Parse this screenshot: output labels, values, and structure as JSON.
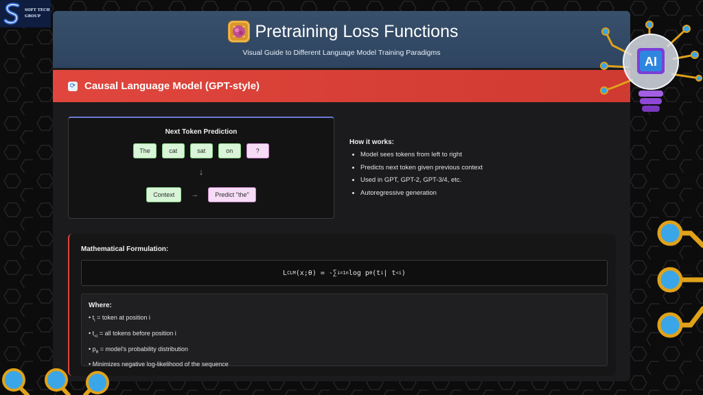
{
  "brand": {
    "line1": "SOFT TECH",
    "line2": "GROUP"
  },
  "header": {
    "title": "Pretraining Loss Functions",
    "subtitle": "Visual Guide to Different Language Model Training Paradigms"
  },
  "section": {
    "title": "Causal Language Model (GPT-style)",
    "icon": "refresh-icon"
  },
  "token_panel": {
    "title": "Next Token Prediction",
    "tokens": [
      "The",
      "cat",
      "sat",
      "on",
      "?"
    ],
    "arrow_down": "↓",
    "context_label": "Context",
    "arrow_right": "→",
    "prediction_label": "Predict \"the\""
  },
  "how": {
    "title": "How it works:",
    "items": [
      "Model sees tokens from left to right",
      "Predicts next token given previous context",
      "Used in GPT, GPT-2, GPT-3/4, etc.",
      "Autoregressive generation"
    ]
  },
  "math": {
    "title": "Mathematical Formulation:",
    "formula": {
      "lhs": "L",
      "lhs_sub": "CLM",
      "args": "(x;θ) = -∑",
      "sum_sub": "i=1",
      "sum_sup": "n",
      "rest": " log p",
      "p_sub": "θ",
      "paren_open": "(t",
      "t_sub": "i",
      "bar": " | t",
      "ctx_sub": "<i",
      "paren_close": ")"
    },
    "where_title": "Where:",
    "where": [
      {
        "pre": "• t",
        "sub": "i",
        "post": " = token at position i"
      },
      {
        "pre": "• t",
        "sub": "<i",
        "post": " = all tokens before position i"
      },
      {
        "pre": "• p",
        "sub": "θ",
        "post": " = model's probability distribution"
      },
      {
        "pre": "• Minimizes negative log-likelihood of the sequence",
        "sub": "",
        "post": ""
      }
    ]
  },
  "decor": {
    "bulb_label": "AI"
  },
  "colors": {
    "header": "#38506b",
    "accent_red": "#e0463d",
    "token_green": "#d8f5d7",
    "token_pink": "#f6dcf6",
    "gold": "#e0a21a",
    "node_blue": "#3aa6e8"
  }
}
